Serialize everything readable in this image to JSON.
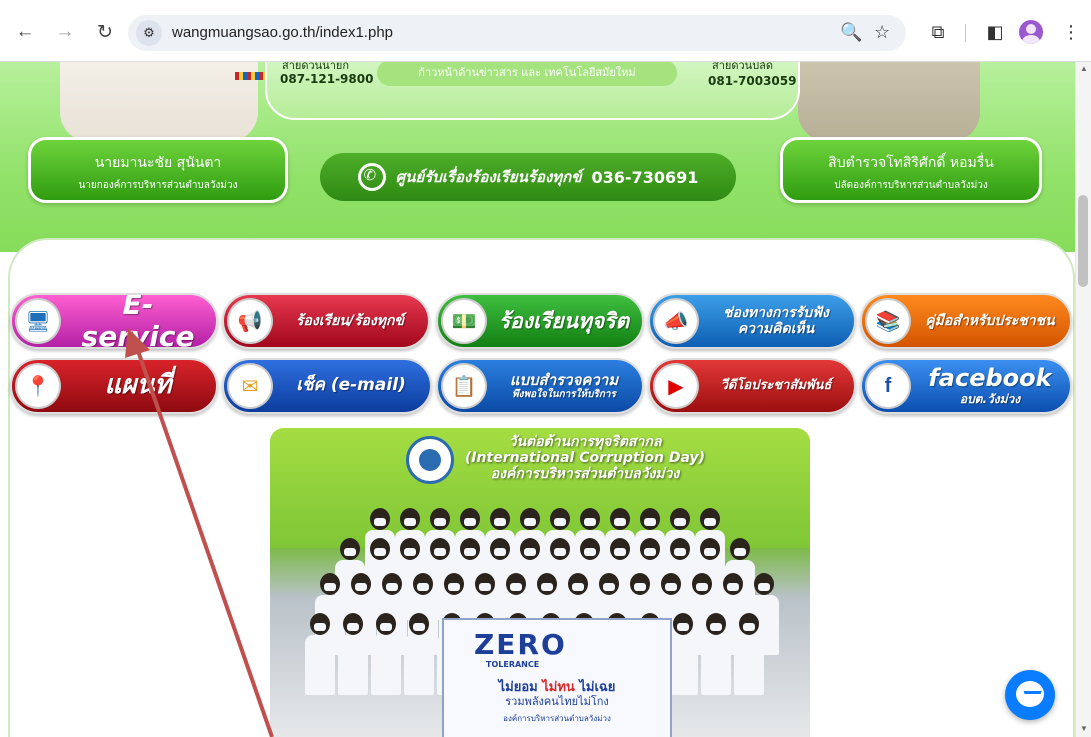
{
  "browser": {
    "url": "wangmuangsao.go.th/index1.php",
    "back_glyph": "←",
    "forward_glyph": "→",
    "reload_glyph": "↻",
    "site_info_glyph": "⚙",
    "zoom_glyph": "🔍",
    "star_glyph": "☆",
    "ext_glyph": "⧉",
    "panel_glyph": "◧",
    "menu_glyph": "⋮"
  },
  "header": {
    "left_phone": "087-121-9800",
    "left_role_top": "นายกองค์การบริหารส่วนตำบลวังม่วง",
    "right_phone": "081-7003059",
    "tagline": "ก้าวหน้าด้านข่าวสาร และ เทคโนโลยีสมัยใหม่",
    "left_name": "นายมานะชัย สุนันตา",
    "left_role": "นายกองค์การบริหารส่วนตำบลวังม่วง",
    "right_name": "สิบตำรวจโทสิริศักดิ์ หอมรื่น",
    "right_role": "ปลัดองค์การบริหารส่วนตำบลวังม่วง",
    "hotline_label": "ศูนย์รับเรื่องร้องเรียนร้องทุกข์",
    "hotline_number": "036-730691"
  },
  "services": {
    "eservice": "E-service",
    "complaint": "ร้องเรียน/ร้องทุกข์",
    "corruption": "ร้องเรียนทุจริต",
    "opinion_1": "ช่องทางการรับฟัง",
    "opinion_2": "ความคิดเห็น",
    "manual": "คู่มือสำหรับประชาชน",
    "map": "แผนที่",
    "email": "เช็ค (e-mail)",
    "survey_1": "แบบสำรวจความ",
    "survey_2": "พึงพอใจในการให้บริการ",
    "video": "วีดีโอประชาสัมพันธ์",
    "facebook_1": "facebook",
    "facebook_2": "อบต.วังม่วง"
  },
  "photo": {
    "caption_1": "วันต่อต้านการทุจริตสากล",
    "caption_2": "(International Corruption Day)",
    "caption_3": "องค์การบริหารส่วนตำบลวังม่วง",
    "sign_title": "ZERO",
    "sign_sub": "TOLERANCE",
    "sign_line_a": "ไม่ยอม",
    "sign_line_b": "ไม่ทน",
    "sign_line_c": "ไม่เฉย",
    "sign_line_2": "รวมพลังคนไทยไม่โกง",
    "sign_line_3": "องค์การบริหารส่วนตำบลวังม่วง"
  },
  "colors": {
    "banner_green": "#92e26a",
    "badge_green": "#2f9c10",
    "annotation_arrow": "#c0504d",
    "messenger_blue": "#0a7cff"
  }
}
